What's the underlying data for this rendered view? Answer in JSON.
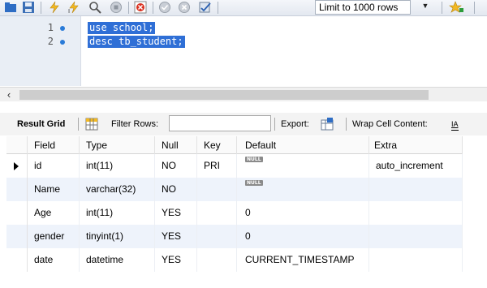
{
  "toolbar": {
    "limit_select": {
      "value": "Limit to 1000 rows"
    },
    "icons": [
      "folder-icon",
      "save-icon",
      "execute-icon",
      "execute-current-icon",
      "explain-icon",
      "stop-icon",
      "toggle-error-icon",
      "commit-icon",
      "rollback-icon",
      "autocommit-icon",
      "beautify-icon"
    ]
  },
  "editor": {
    "lines": [
      {
        "number": "1",
        "code": "use school;"
      },
      {
        "number": "2",
        "code": "desc tb_student;"
      }
    ]
  },
  "result_bar": {
    "tab_label": "Result Grid",
    "filter_label": "Filter Rows:",
    "filter_value": "",
    "export_label": "Export:",
    "wrap_label": "Wrap Cell Content:",
    "wrap_icon_glyph": "IA"
  },
  "grid": {
    "columns": [
      "Field",
      "Type",
      "Null",
      "Key",
      "Default",
      "Extra"
    ],
    "rows": [
      {
        "field": "id",
        "type": "int(11)",
        "null": "NO",
        "key": "PRI",
        "default": "NULL",
        "default_is_null": true,
        "extra": "auto_increment",
        "selected": true
      },
      {
        "field": "Name",
        "type": "varchar(32)",
        "null": "NO",
        "key": "",
        "default": "NULL",
        "default_is_null": true,
        "extra": ""
      },
      {
        "field": "Age",
        "type": "int(11)",
        "null": "YES",
        "key": "",
        "default": "0",
        "default_is_null": false,
        "extra": ""
      },
      {
        "field": "gender",
        "type": "tinyint(1)",
        "null": "YES",
        "key": "",
        "default": "0",
        "default_is_null": false,
        "extra": ""
      },
      {
        "field": "date",
        "type": "datetime",
        "null": "YES",
        "key": "",
        "default": "CURRENT_TIMESTAMP",
        "default_is_null": false,
        "extra": ""
      }
    ]
  }
}
